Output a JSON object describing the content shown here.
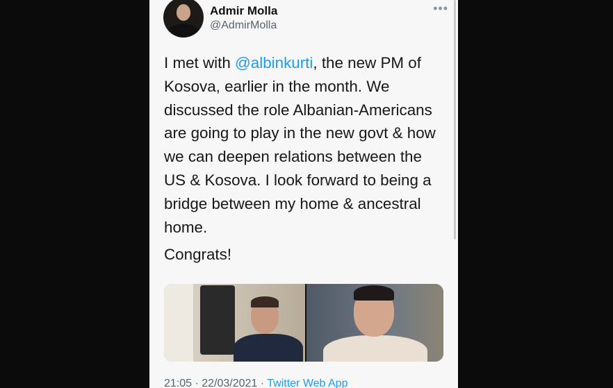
{
  "author": {
    "name": "Admir Molla",
    "handle": "@AdmirMolla"
  },
  "more_label": "•••",
  "tweet": {
    "line1_pre": "I met with ",
    "mention": "@albinkurti",
    "line1_post": ", the new PM of",
    "lines": [
      "Kosova, earlier in the month. We",
      "discussed the role Albanian-Americans",
      "are going to play in the new govt & how",
      "we can deepen relations between the",
      "US & Kosova. I look forward to being a",
      "bridge between my home & ancestral",
      "home."
    ],
    "closing": "Congrats!"
  },
  "footer": {
    "time_date": "21:05 · 22/03/2021 · ",
    "app": "Twitter Web App"
  },
  "colors": {
    "link": "#1d9bf0",
    "text": "#171717",
    "muted": "#566370"
  }
}
